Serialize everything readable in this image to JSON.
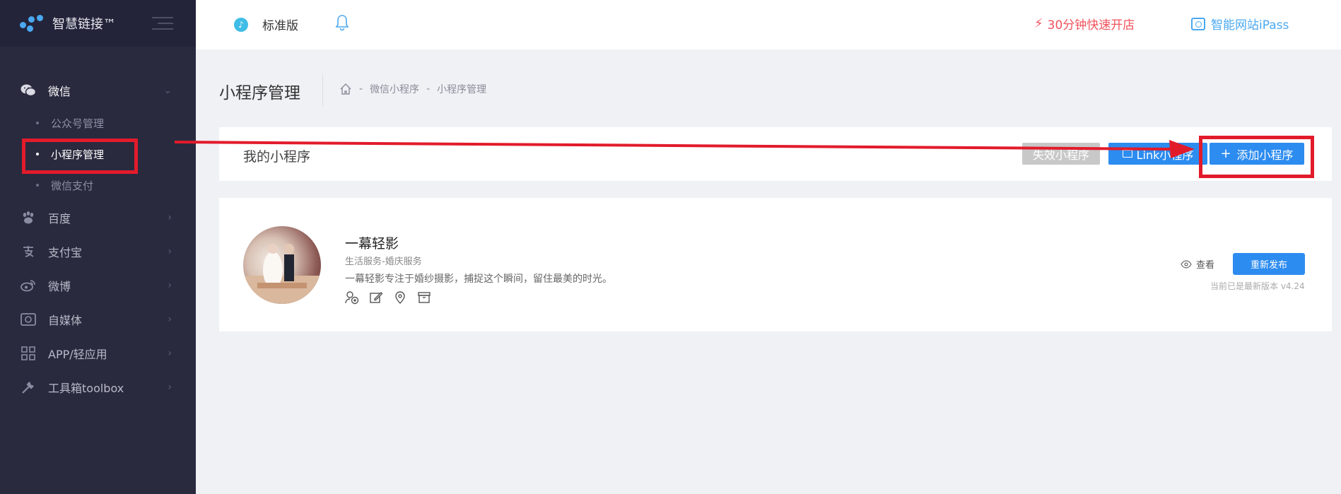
{
  "brand": {
    "name": "智慧链接™"
  },
  "sidebar": {
    "sections": [
      {
        "label": "微信",
        "icon": "wechat-icon",
        "open": true,
        "children": [
          {
            "label": "公众号管理",
            "active": false
          },
          {
            "label": "小程序管理",
            "active": true
          },
          {
            "label": "微信支付",
            "active": false
          }
        ]
      },
      {
        "label": "百度",
        "icon": "paw-icon"
      },
      {
        "label": "支付宝",
        "icon": "alipay-icon"
      },
      {
        "label": "微博",
        "icon": "weibo-icon"
      },
      {
        "label": "自媒体",
        "icon": "media-icon"
      },
      {
        "label": "APP/轻应用",
        "icon": "app-grid-icon"
      },
      {
        "label": "工具箱toolbox",
        "icon": "wrench-icon"
      }
    ]
  },
  "header": {
    "edition": "标准版",
    "quick_open": "30分钟快速开店",
    "ipass": "智能网站iPass"
  },
  "page": {
    "title": "小程序管理",
    "breadcrumb": [
      "微信小程序",
      "小程序管理"
    ]
  },
  "mini_programs": {
    "heading": "我的小程序",
    "invalid_label": "失效小程序",
    "link_label": "Link小程序",
    "add_label": "添加小程序"
  },
  "app": {
    "name": "一幕轻影",
    "category": "生活服务-婚庆服务",
    "description": "一幕轻影专注于婚纱摄影，捕捉这个瞬间，留住最美的时光。",
    "view_label": "查看",
    "republish_label": "重新发布",
    "version_note": "当前已是最新版本 v4.24"
  },
  "colors": {
    "sidebar_bg": "#292a3e",
    "primary": "#2d8cf0",
    "accent_red": "#f0525c",
    "annotation": "#e21b2b"
  }
}
